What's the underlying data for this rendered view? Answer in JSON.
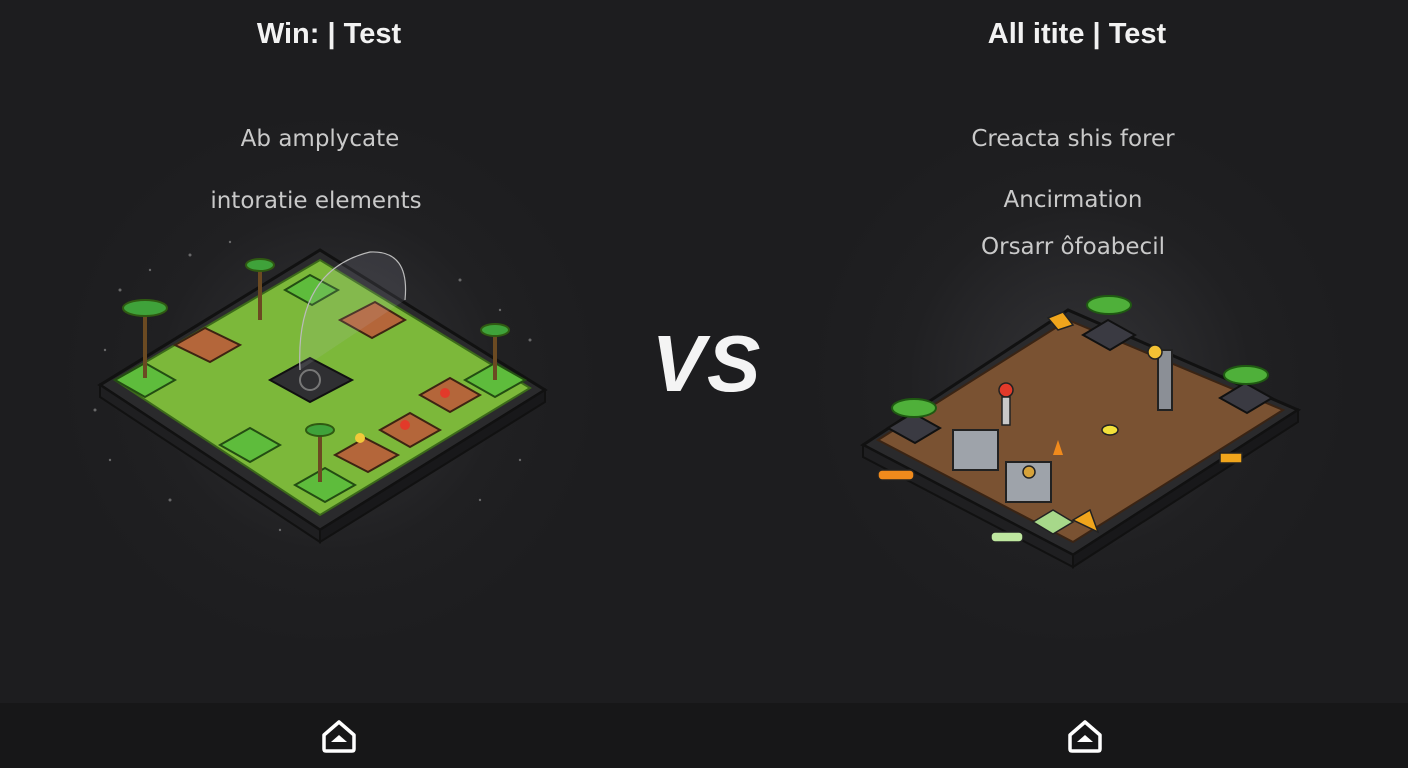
{
  "left_panel": {
    "title": "Win: | Test",
    "lines": [
      "Ab amplycate",
      "intoratie elements"
    ]
  },
  "right_panel": {
    "title": "All itite | Test",
    "lines": [
      "Creacta shis forer",
      "Ancirmation",
      "Orsarr ôfoabecil"
    ]
  },
  "vs_label": "VS",
  "icons": {
    "left_home": "home-icon",
    "right_home": "home-icon"
  },
  "colors": {
    "background": "#1d1d1f",
    "grass": "#7cb83a",
    "dirt": "#7a5232",
    "accent_orange": "#f08a1c"
  }
}
